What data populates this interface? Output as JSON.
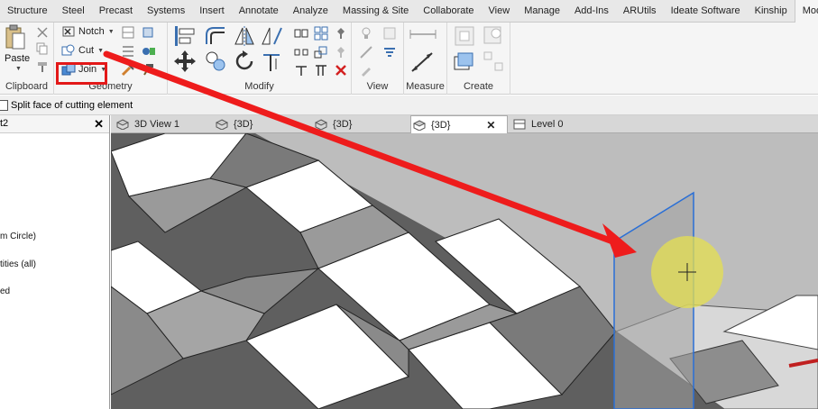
{
  "ribbon": {
    "tabs": [
      "Structure",
      "Steel",
      "Precast",
      "Systems",
      "Insert",
      "Annotate",
      "Analyze",
      "Massing & Site",
      "Collaborate",
      "View",
      "Manage",
      "Add-Ins",
      "ARUtils",
      "Ideate Software",
      "Kinship",
      "Modify"
    ],
    "active_tab": "Modify",
    "panels": {
      "clipboard": {
        "label": "Clipboard",
        "paste_label": "Paste"
      },
      "geometry": {
        "label": "Geometry",
        "notch_label": "Notch",
        "cut_label": "Cut",
        "join_label": "Join"
      },
      "modify": {
        "label": "Modify"
      },
      "view": {
        "label": "View"
      },
      "measure": {
        "label": "Measure"
      },
      "create": {
        "label": "Create"
      }
    }
  },
  "options_bar": {
    "checkbox_label": "Split face of cutting element"
  },
  "left_panel": {
    "title": "t2",
    "items": [
      "m Circle)",
      "tities (all)",
      "ed"
    ]
  },
  "view_tabs": [
    {
      "label": "3D View 1"
    },
    {
      "label": "{3D}"
    },
    {
      "label": "{3D}"
    },
    {
      "label": "{3D}",
      "active": true
    },
    {
      "label": "Level 0"
    }
  ],
  "colors": {
    "highlight_red": "#e31919",
    "arrow_red": "#ee1c1c",
    "selection_blue": "#2a6fd6",
    "cursor_yellow": "#e6e050"
  }
}
